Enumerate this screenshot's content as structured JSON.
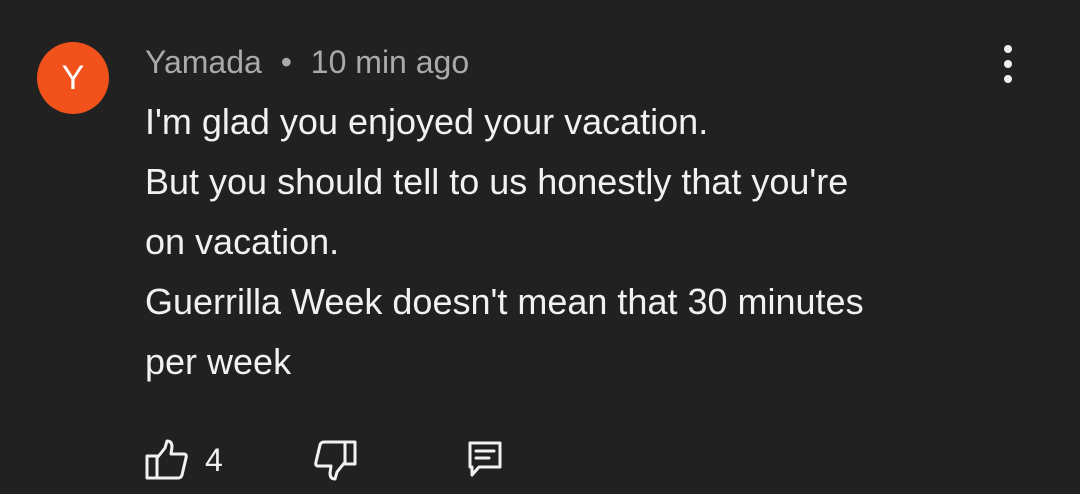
{
  "comment": {
    "avatar_letter": "Y",
    "avatar_color": "#f1511b",
    "author": "Yamada",
    "separator": "•",
    "timestamp": "10 min ago",
    "text_lines": [
      "I'm glad you enjoyed your vacation.",
      "But you should tell to us honestly that you're",
      "on vacation.",
      "Guerrilla Week doesn't mean that 30 minutes",
      "per week"
    ],
    "like_count": "4",
    "icons": {
      "menu": "more-vertical-icon",
      "like": "thumbs-up-icon",
      "dislike": "thumbs-down-icon",
      "reply": "comment-reply-icon"
    }
  },
  "colors": {
    "background": "#212121",
    "primary_text": "#f1f1f1",
    "secondary_text": "#aaaaaa"
  }
}
